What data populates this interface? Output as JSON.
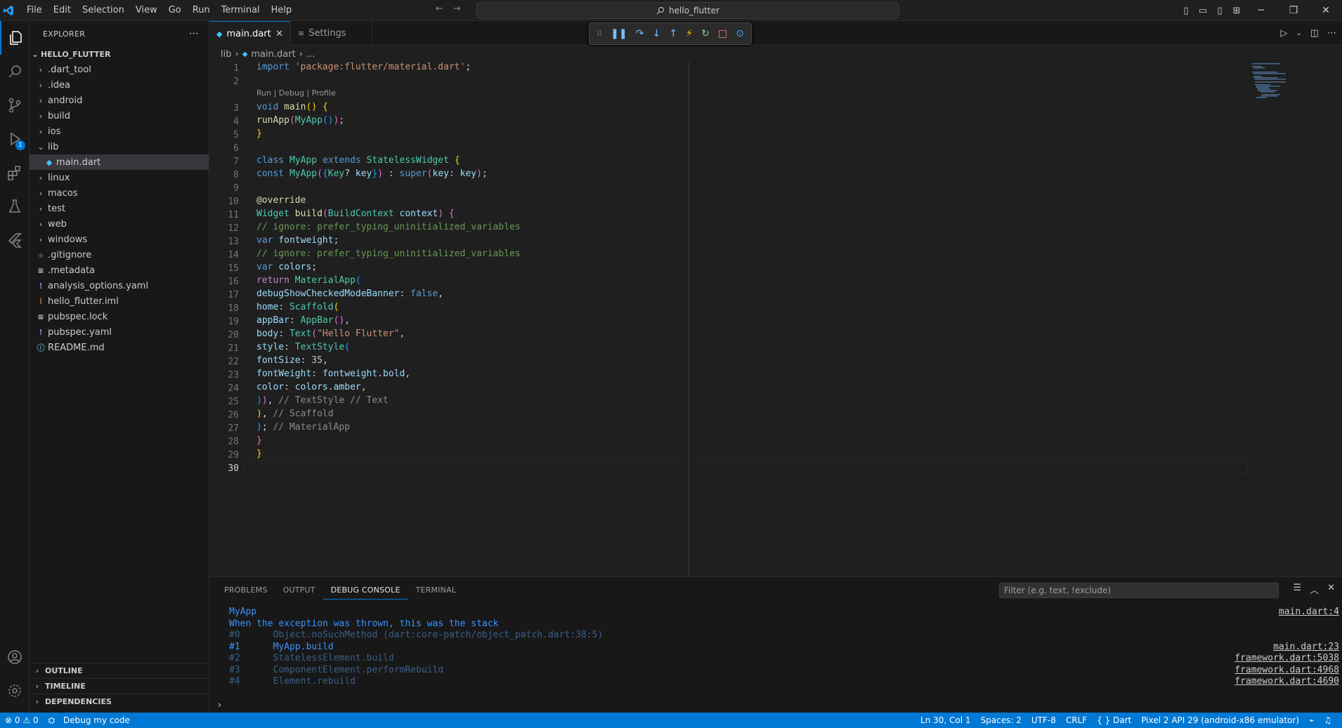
{
  "menu": [
    "File",
    "Edit",
    "Selection",
    "View",
    "Go",
    "Run",
    "Terminal",
    "Help"
  ],
  "command_center": "hello_flutter",
  "explorer": {
    "title": "EXPLORER",
    "root": "HELLO_FLUTTER",
    "items": [
      {
        "label": ".dart_tool",
        "type": "folder",
        "depth": 1
      },
      {
        "label": ".idea",
        "type": "folder",
        "depth": 1
      },
      {
        "label": "android",
        "type": "folder",
        "depth": 1
      },
      {
        "label": "build",
        "type": "folder",
        "depth": 1
      },
      {
        "label": "ios",
        "type": "folder",
        "depth": 1
      },
      {
        "label": "lib",
        "type": "folder-open",
        "depth": 1
      },
      {
        "label": "main.dart",
        "type": "dart",
        "depth": 2,
        "selected": true
      },
      {
        "label": "linux",
        "type": "folder",
        "depth": 1
      },
      {
        "label": "macos",
        "type": "folder",
        "depth": 1
      },
      {
        "label": "test",
        "type": "folder",
        "depth": 1
      },
      {
        "label": "web",
        "type": "folder",
        "depth": 1
      },
      {
        "label": "windows",
        "type": "folder",
        "depth": 1
      },
      {
        "label": ".gitignore",
        "type": "git",
        "depth": 1
      },
      {
        "label": ".metadata",
        "type": "text",
        "depth": 1
      },
      {
        "label": "analysis_options.yaml",
        "type": "yaml",
        "depth": 1
      },
      {
        "label": "hello_flutter.iml",
        "type": "xml",
        "depth": 1
      },
      {
        "label": "pubspec.lock",
        "type": "text",
        "depth": 1
      },
      {
        "label": "pubspec.yaml",
        "type": "yaml",
        "depth": 1
      },
      {
        "label": "README.md",
        "type": "info",
        "depth": 1
      }
    ],
    "sections": [
      "OUTLINE",
      "TIMELINE",
      "DEPENDENCIES"
    ]
  },
  "run_badge": "1",
  "tabs": [
    {
      "label": "main.dart",
      "active": true
    },
    {
      "label": "Settings",
      "active": false
    }
  ],
  "breadcrumb": {
    "folder": "lib",
    "file": "main.dart",
    "more": "..."
  },
  "codelens": "Run | Debug | Profile",
  "code_line_numbers": [
    "1",
    "2",
    "3",
    "4",
    "5",
    "6",
    "7",
    "8",
    "9",
    "10",
    "11",
    "12",
    "13",
    "14",
    "15",
    "16",
    "17",
    "18",
    "19",
    "20",
    "21",
    "22",
    "23",
    "24",
    "25",
    "26",
    "27",
    "28",
    "29",
    "30"
  ],
  "panel": {
    "tabs": [
      "PROBLEMS",
      "OUTPUT",
      "DEBUG CONSOLE",
      "TERMINAL"
    ],
    "active_tab": "DEBUG CONSOLE",
    "filter_placeholder": "Filter (e.g. text, !exclude)",
    "console": [
      {
        "text": "MyApp",
        "src": "main.dart:4",
        "color": "#3794ff"
      },
      {
        "text": "When the exception was thrown, this was the stack",
        "src": "",
        "color": "#3794ff"
      },
      {
        "text": "#0      Object.noSuchMethod (dart:core-patch/object_patch.dart:38:5)",
        "src": "",
        "color": "#3b5f8a"
      },
      {
        "text": "#1      MyApp.build",
        "src": "main.dart:23",
        "color": "#3794ff"
      },
      {
        "text": "#2      StatelessElement.build",
        "src": "framework.dart:5038",
        "color": "#3b5f8a"
      },
      {
        "text": "#3      ComponentElement.performRebuild",
        "src": "framework.dart:4968",
        "color": "#3b5f8a"
      },
      {
        "text": "#4      Element.rebuild",
        "src": "framework.dart:4690",
        "color": "#3b5f8a"
      }
    ]
  },
  "status": {
    "errors": "0",
    "warnings": "0",
    "debug": "Debug my code",
    "position": "Ln 30, Col 1",
    "spaces": "Spaces: 2",
    "encoding": "UTF-8",
    "eol": "CRLF",
    "language": "Dart",
    "device": "Pixel 2 API 29 (android-x86 emulator)"
  }
}
